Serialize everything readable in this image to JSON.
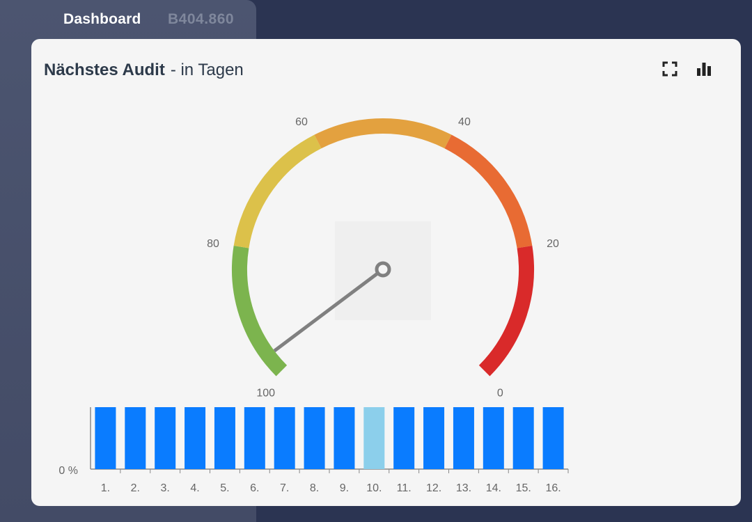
{
  "topbar": {
    "tab_dashboard": "Dashboard",
    "tab_id": "B404.860"
  },
  "card": {
    "title": "Nächstes Audit",
    "subtitle": "- in Tagen",
    "icons": {
      "fullscreen": "fullscreen-icon",
      "chart": "bar-chart-icon"
    }
  },
  "chart_data": [
    {
      "type": "gauge",
      "min": 0,
      "max": 100,
      "reversed": true,
      "tick_labels": [
        "100",
        "80",
        "60",
        "40",
        "20",
        "0"
      ],
      "tick_values": [
        100,
        80,
        60,
        40,
        20,
        0
      ],
      "bands": [
        {
          "from": 100,
          "to": 80,
          "color": "#7cb44e"
        },
        {
          "from": 80,
          "to": 60,
          "color": "#dcc14a"
        },
        {
          "from": 60,
          "to": 40,
          "color": "#e3a13f"
        },
        {
          "from": 40,
          "to": 20,
          "color": "#e86b33"
        },
        {
          "from": 20,
          "to": 0,
          "color": "#d92a2a"
        }
      ],
      "value": 97
    },
    {
      "type": "bar",
      "categories": [
        "1.",
        "2.",
        "3.",
        "4.",
        "5.",
        "6.",
        "7.",
        "8.",
        "9.",
        "10.",
        "11.",
        "12.",
        "13.",
        "14.",
        "15.",
        "16."
      ],
      "values": [
        1,
        1,
        1,
        1,
        1,
        1,
        1,
        1,
        1,
        1,
        1,
        1,
        1,
        1,
        1,
        1
      ],
      "highlight_index": 9,
      "bar_color": "#0a7cff",
      "highlight_color": "#8ccfeb",
      "y_tick_label": "0 %"
    }
  ]
}
